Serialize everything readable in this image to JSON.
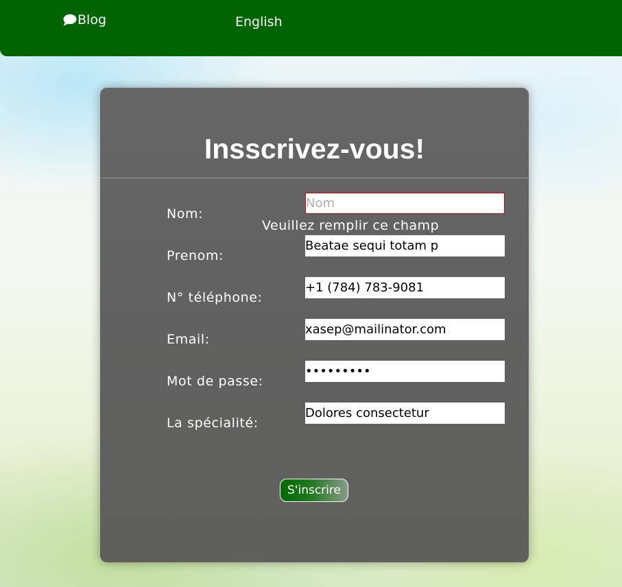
{
  "nav": {
    "blog_icon": "speech-bubble-icon",
    "blog_label": "Blog",
    "language_label": "English",
    "background_color": "#006400"
  },
  "form": {
    "title": "Insscrivez-vous!",
    "fields": [
      {
        "label": "Nom:",
        "placeholder": "Nom",
        "value": ""
      },
      {
        "label": "Prenom:",
        "placeholder": "",
        "value": "Beatae sequi totam p"
      },
      {
        "label": "N° téléphone:",
        "placeholder": "",
        "value": "+1 (784) 783-9081"
      },
      {
        "label": "Email:",
        "placeholder": "",
        "value": "xasep@mailinator.com"
      },
      {
        "label": "Mot de passe:",
        "placeholder": "",
        "value": "•••••••••"
      },
      {
        "label": "La spécialité:",
        "placeholder": "",
        "value": "Dolores consectetur"
      }
    ],
    "validation_message": "Veuillez remplir ce champ",
    "submit_label": "S'inscrire",
    "invalid_border_color": "#cc0000"
  }
}
